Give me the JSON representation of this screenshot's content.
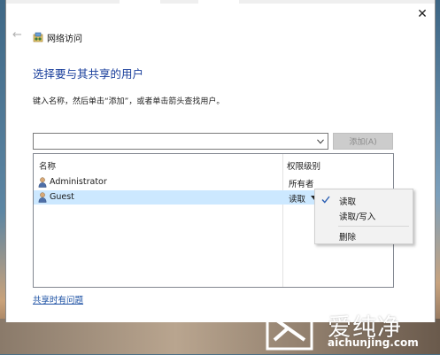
{
  "window": {
    "title": "网络访问",
    "close_symbol": "✕",
    "back_symbol": "←"
  },
  "heading": "选择要与其共享的用户",
  "instructions": "键入名称，然后单击“添加”，或者单击箭头查找用户。",
  "combo": {
    "value": ""
  },
  "add_button": {
    "label": "添加(A)"
  },
  "list": {
    "columns": {
      "name": "名称",
      "permission": "权限级别"
    },
    "rows": [
      {
        "name": "Administrator",
        "permission": "所有者"
      },
      {
        "name": "Guest",
        "permission": "读取"
      }
    ]
  },
  "context_menu": {
    "items": [
      {
        "label": "读取",
        "checked": true
      },
      {
        "label": "读取/写入",
        "checked": false
      },
      {
        "label": "删除",
        "checked": false
      }
    ],
    "check_symbol": "✓"
  },
  "help_link": "共享时有问题",
  "watermark": {
    "cn": "爱纯净",
    "en": "aichunjing.com"
  },
  "colors": {
    "heading": "#1a3f9c",
    "selected_row": "#cce8ff",
    "link": "#1a4fa3"
  }
}
